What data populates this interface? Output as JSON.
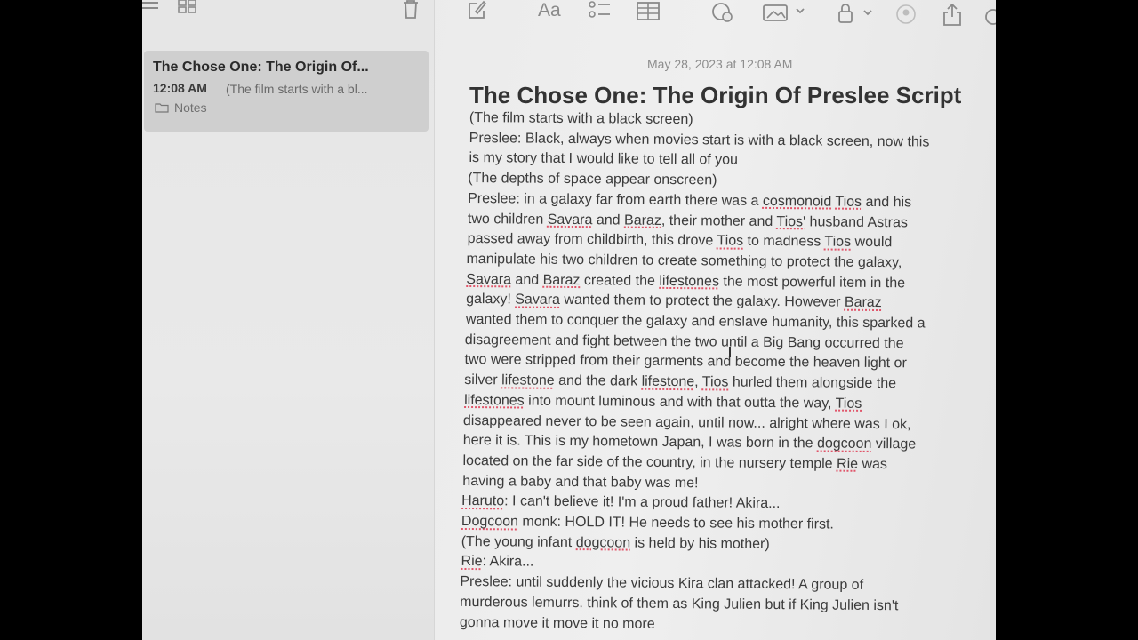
{
  "toolbar": {
    "icons": [
      "sidebar-icon",
      "grid-icon",
      "trash-icon",
      "compose-icon",
      "format-icon",
      "checklist-icon",
      "table-icon",
      "collab-icon",
      "media-icon",
      "lock-icon",
      "share-collab-icon",
      "share-icon",
      "search-icon"
    ],
    "format_label": "Aa"
  },
  "note_list": {
    "items": [
      {
        "title": "The Chose One: The Origin Of...",
        "time": "12:08 AM",
        "preview": "(The film starts with a bl...",
        "folder": "Notes"
      }
    ]
  },
  "note": {
    "date": "May 28, 2023 at 12:08 AM",
    "title": "The Chose One: The Origin Of Preslee Script",
    "lines": [
      "(The film starts with a black screen)",
      "Preslee: Black, always when movies start is with a black screen, now this",
      "is my story that I would like to tell all of you",
      "(The depths of space appear onscreen)",
      "Preslee: in a galaxy far from earth there was a cosmonoid Tios and his",
      "two children Savara and Baraz, their mother and Tios' husband Astras",
      "passed away from childbirth, this drove Tios to madness Tios would",
      "manipulate his two children to create something to protect the galaxy,",
      "Savara and Baraz created the lifestones the most powerful item in the",
      "galaxy! Savara wanted them to protect the galaxy. However Baraz",
      "wanted them to conquer the galaxy and enslave humanity, this sparked a",
      "disagreement and fight between the two until a Big Bang occurred the",
      "two were stripped from their garments and become the heaven light or",
      "silver lifestone and the dark lifestone, Tios hurled them alongside the",
      "lifestones into mount luminous and with that outta the way, Tios",
      "disappeared never to be seen again, until now... alright where was I ok,",
      "here it is. This is my hometown Japan, I was born in the dogcoon village",
      "located on the far side of the country, in the nursery temple Rie was",
      "having a baby and that baby was me!",
      "Haruto: I can't believe it! I'm a proud father! Akira...",
      "Dogcoon monk: HOLD IT! He needs to see his mother first.",
      "(The young infant dogcoon is held by his mother)",
      "Rie: Akira...",
      "Preslee: until suddenly the vicious Kira clan attacked! A group of",
      "murderous lemurrs. think of them as King Julien but if King Julien isn't",
      "gonna move it move it no more"
    ],
    "misspelled": [
      "cosmonoid",
      "Tios",
      "Savara",
      "Baraz",
      "Tios'",
      "lifestones",
      "lifestone",
      "dogcoon",
      "Rie",
      "Haruto",
      "Dogcoon"
    ]
  },
  "colors": {
    "spell_underline": "#e0556a",
    "selected_note": "#cfcfcf"
  }
}
